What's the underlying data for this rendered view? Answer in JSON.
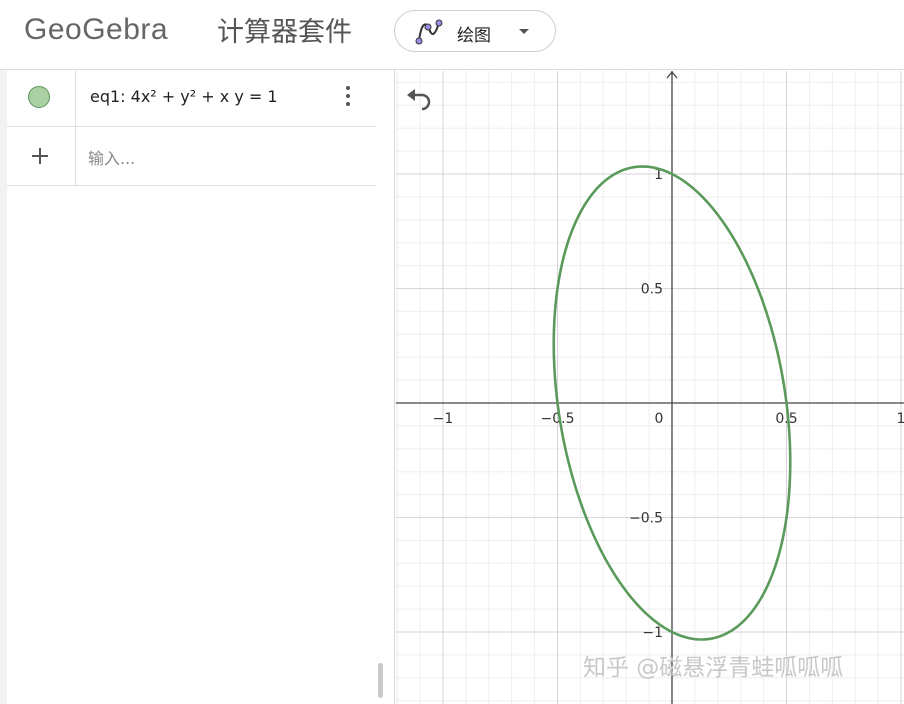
{
  "header": {
    "logo_text": "GeoGebra",
    "app_name": "计算器套件",
    "app_switcher": {
      "label": "绘图",
      "icon": "graphing-icon"
    }
  },
  "algebra": {
    "rows": [
      {
        "type": "equation",
        "text": "eq1: 4x² + y² + x y = 1",
        "marble_color": "#a9cfa2",
        "menu_icon": "kebab-menu-icon"
      }
    ],
    "input": {
      "placeholder": "输入..."
    }
  },
  "graphics": {
    "undo_icon": "undo-icon",
    "axis_ticks_x": [
      "−1",
      "−0.5",
      "0",
      "0.5",
      "1"
    ],
    "axis_ticks_y": [
      "1",
      "0.5",
      "−0.5",
      "−1"
    ],
    "curve": {
      "equation": "4x² + y² + xy = 1",
      "color": "#5a9a5a"
    },
    "watermark": "知乎 @磁悬浮青蛙呱呱呱"
  }
}
